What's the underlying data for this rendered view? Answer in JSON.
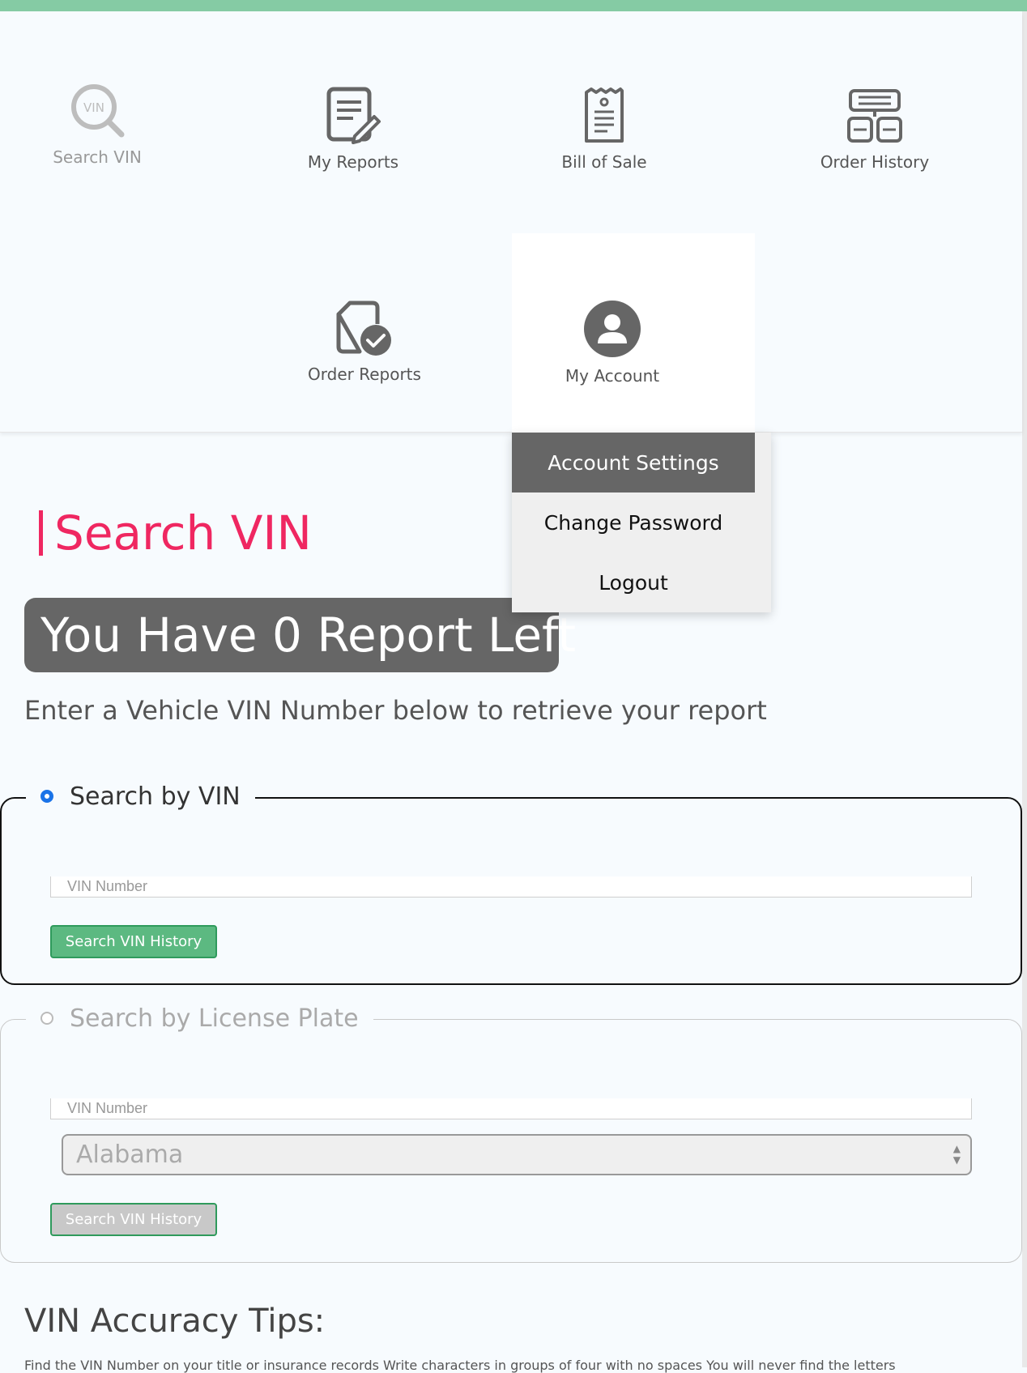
{
  "nav": {
    "items": [
      {
        "label": "Search VIN",
        "icon": "search-vin-icon"
      },
      {
        "label": "My Reports",
        "icon": "report-edit-icon"
      },
      {
        "label": "Bill of Sale",
        "icon": "receipt-icon"
      },
      {
        "label": "Order History",
        "icon": "order-history-icon"
      },
      {
        "label": "Order Reports",
        "icon": "document-check-icon"
      },
      {
        "label": "My Account",
        "icon": "user-circle-icon"
      }
    ],
    "search_icon_text": "VIN"
  },
  "account_menu": {
    "items": [
      "Account Settings",
      "Change Password",
      "Logout"
    ],
    "active": "Account Settings"
  },
  "main": {
    "title": "Search VIN",
    "reports_left": "You Have 0 Report Left",
    "subtitle": "Enter a Vehicle VIN Number below to retrieve your report"
  },
  "search_by_vin": {
    "legend": "Search by VIN",
    "selected": true,
    "input_placeholder": "VIN Number",
    "button": "Search VIN History"
  },
  "search_by_plate": {
    "legend": "Search by License Plate",
    "selected": false,
    "input_placeholder": "VIN Number",
    "state": "Alabama",
    "button": "Search VIN History"
  },
  "tips": {
    "title": "VIN Accuracy Tips:",
    "text": "Find the VIN Number on your title or insurance records Write characters in groups of four with no spaces You will never find the letters"
  },
  "colors": {
    "accent": "#ef2761",
    "top_bar": "#85cba4",
    "button_green": "#5cb981",
    "dark_gray": "#666666",
    "radio_blue": "#1a73e8"
  }
}
